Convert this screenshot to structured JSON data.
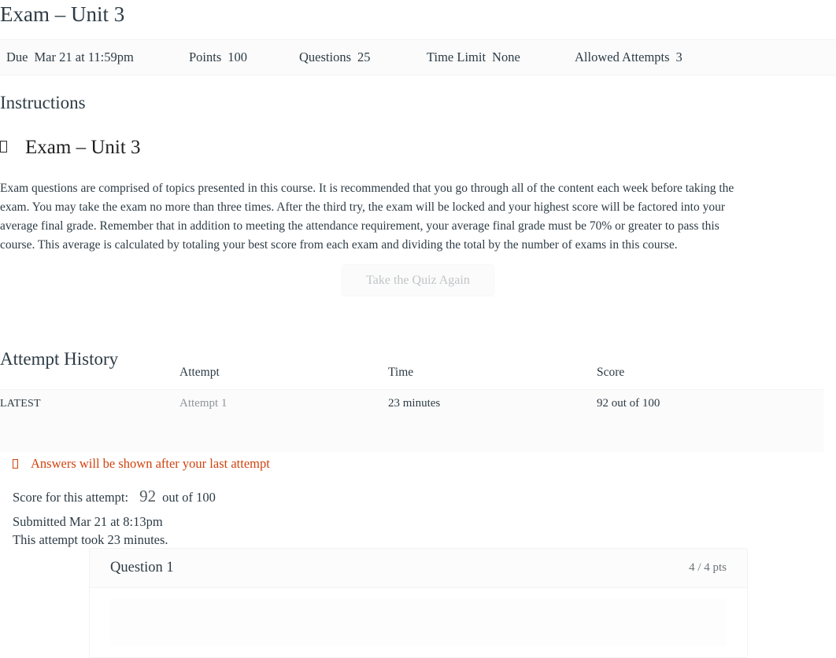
{
  "quiz": {
    "title": "Exam – Unit 3"
  },
  "details": [
    {
      "label": "Due",
      "value": "Mar 21 at 11:59pm",
      "name": "due"
    },
    {
      "label": "Points",
      "value": "100",
      "name": "points"
    },
    {
      "label": "Questions",
      "value": "25",
      "name": "questions"
    },
    {
      "label": "Time Limit",
      "value": "None",
      "name": "time-limit"
    },
    {
      "label": "Allowed Attempts",
      "value": "3",
      "name": "allowed-attempts"
    }
  ],
  "instructions": {
    "heading": "Instructions",
    "doc_icon": "missing-glyph-icon",
    "doc_title": "Exam – Unit 3",
    "body": "Exam questions are comprised of topics presented in this course. It is recommended that you go through all of the content each week before taking the exam. You may take the exam no more than three times. After the third try, the exam will be locked and your highest score will be factored into your average final grade. Remember that in addition to meeting the attendance requirement, your average final grade must be 70% or greater to pass this course. This average is calculated by totaling your best score from each exam and dividing the total by the number of exams in this course."
  },
  "actions": {
    "take_quiz_again": "Take the Quiz Again"
  },
  "attempt_history": {
    "heading": "Attempt History",
    "columns": [
      "",
      "Attempt",
      "Time",
      "Score"
    ],
    "rows": [
      {
        "kept": "LATEST",
        "attempt": "Attempt 1",
        "time": "23 minutes",
        "score": "92 out of 100"
      }
    ]
  },
  "answers_notice": {
    "icon": "warning-icon",
    "text": "Answers will be shown after your last attempt",
    "color": "#d0430e"
  },
  "score_summary": {
    "label": "Score for this attempt:",
    "value": "92",
    "out_of": "out of 100",
    "submitted": "Submitted Mar 21 at 8:13pm",
    "duration": "This attempt took 23 minutes."
  },
  "questions": [
    {
      "name": "Question 1",
      "points": "4 / 4 pts"
    }
  ]
}
